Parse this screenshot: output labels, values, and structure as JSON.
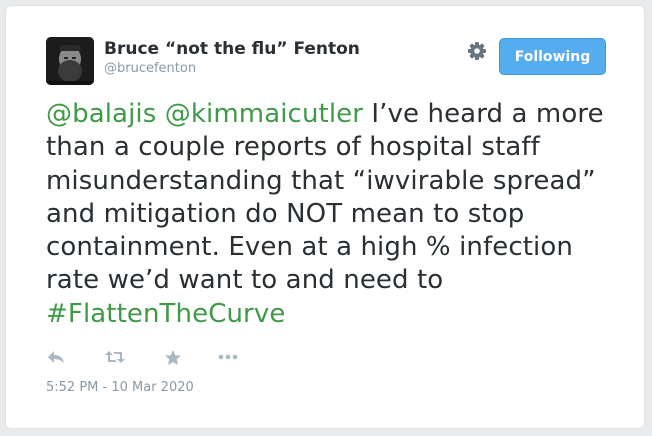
{
  "user": {
    "display_name": "Bruce “not the flu” Fenton",
    "handle": "@brucefenton"
  },
  "follow_button": {
    "label": "Following"
  },
  "tweet": {
    "mention_1": "@balajis",
    "mention_2": "@kimmaicutler",
    "text_line_1": " I’ve heard a",
    "text_rest": "more than a couple reports of hospital staff misunderstanding that “iwvirable spread” and mitigation do NOT mean to stop containment. Even at a high % infection rate we’d want to and need to ",
    "hashtag": "#FlattenTheCurve"
  },
  "timestamp": "5:52 PM - 10 Mar 2020",
  "colors": {
    "link": "#3f9a48",
    "follow_button": "#55acee",
    "text": "#292f33",
    "muted": "#8899a6"
  },
  "icons": [
    "reply-icon",
    "retweet-icon",
    "favorite-icon",
    "more-icon",
    "gear-icon"
  ]
}
